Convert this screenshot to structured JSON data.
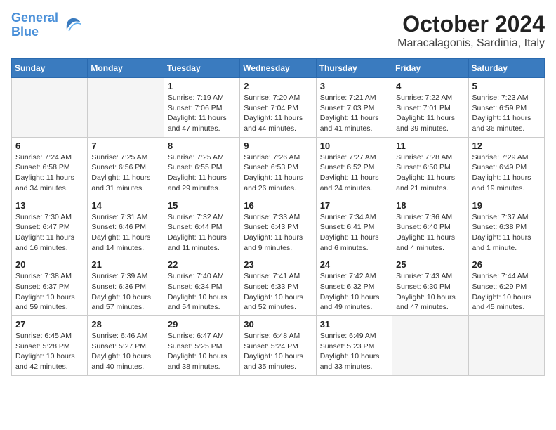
{
  "header": {
    "logo_line1": "General",
    "logo_line2": "Blue",
    "month_year": "October 2024",
    "location": "Maracalagonis, Sardinia, Italy"
  },
  "days_of_week": [
    "Sunday",
    "Monday",
    "Tuesday",
    "Wednesday",
    "Thursday",
    "Friday",
    "Saturday"
  ],
  "weeks": [
    [
      {
        "day": "",
        "info": ""
      },
      {
        "day": "",
        "info": ""
      },
      {
        "day": "1",
        "info": "Sunrise: 7:19 AM\nSunset: 7:06 PM\nDaylight: 11 hours and 47 minutes."
      },
      {
        "day": "2",
        "info": "Sunrise: 7:20 AM\nSunset: 7:04 PM\nDaylight: 11 hours and 44 minutes."
      },
      {
        "day": "3",
        "info": "Sunrise: 7:21 AM\nSunset: 7:03 PM\nDaylight: 11 hours and 41 minutes."
      },
      {
        "day": "4",
        "info": "Sunrise: 7:22 AM\nSunset: 7:01 PM\nDaylight: 11 hours and 39 minutes."
      },
      {
        "day": "5",
        "info": "Sunrise: 7:23 AM\nSunset: 6:59 PM\nDaylight: 11 hours and 36 minutes."
      }
    ],
    [
      {
        "day": "6",
        "info": "Sunrise: 7:24 AM\nSunset: 6:58 PM\nDaylight: 11 hours and 34 minutes."
      },
      {
        "day": "7",
        "info": "Sunrise: 7:25 AM\nSunset: 6:56 PM\nDaylight: 11 hours and 31 minutes."
      },
      {
        "day": "8",
        "info": "Sunrise: 7:25 AM\nSunset: 6:55 PM\nDaylight: 11 hours and 29 minutes."
      },
      {
        "day": "9",
        "info": "Sunrise: 7:26 AM\nSunset: 6:53 PM\nDaylight: 11 hours and 26 minutes."
      },
      {
        "day": "10",
        "info": "Sunrise: 7:27 AM\nSunset: 6:52 PM\nDaylight: 11 hours and 24 minutes."
      },
      {
        "day": "11",
        "info": "Sunrise: 7:28 AM\nSunset: 6:50 PM\nDaylight: 11 hours and 21 minutes."
      },
      {
        "day": "12",
        "info": "Sunrise: 7:29 AM\nSunset: 6:49 PM\nDaylight: 11 hours and 19 minutes."
      }
    ],
    [
      {
        "day": "13",
        "info": "Sunrise: 7:30 AM\nSunset: 6:47 PM\nDaylight: 11 hours and 16 minutes."
      },
      {
        "day": "14",
        "info": "Sunrise: 7:31 AM\nSunset: 6:46 PM\nDaylight: 11 hours and 14 minutes."
      },
      {
        "day": "15",
        "info": "Sunrise: 7:32 AM\nSunset: 6:44 PM\nDaylight: 11 hours and 11 minutes."
      },
      {
        "day": "16",
        "info": "Sunrise: 7:33 AM\nSunset: 6:43 PM\nDaylight: 11 hours and 9 minutes."
      },
      {
        "day": "17",
        "info": "Sunrise: 7:34 AM\nSunset: 6:41 PM\nDaylight: 11 hours and 6 minutes."
      },
      {
        "day": "18",
        "info": "Sunrise: 7:36 AM\nSunset: 6:40 PM\nDaylight: 11 hours and 4 minutes."
      },
      {
        "day": "19",
        "info": "Sunrise: 7:37 AM\nSunset: 6:38 PM\nDaylight: 11 hours and 1 minute."
      }
    ],
    [
      {
        "day": "20",
        "info": "Sunrise: 7:38 AM\nSunset: 6:37 PM\nDaylight: 10 hours and 59 minutes."
      },
      {
        "day": "21",
        "info": "Sunrise: 7:39 AM\nSunset: 6:36 PM\nDaylight: 10 hours and 57 minutes."
      },
      {
        "day": "22",
        "info": "Sunrise: 7:40 AM\nSunset: 6:34 PM\nDaylight: 10 hours and 54 minutes."
      },
      {
        "day": "23",
        "info": "Sunrise: 7:41 AM\nSunset: 6:33 PM\nDaylight: 10 hours and 52 minutes."
      },
      {
        "day": "24",
        "info": "Sunrise: 7:42 AM\nSunset: 6:32 PM\nDaylight: 10 hours and 49 minutes."
      },
      {
        "day": "25",
        "info": "Sunrise: 7:43 AM\nSunset: 6:30 PM\nDaylight: 10 hours and 47 minutes."
      },
      {
        "day": "26",
        "info": "Sunrise: 7:44 AM\nSunset: 6:29 PM\nDaylight: 10 hours and 45 minutes."
      }
    ],
    [
      {
        "day": "27",
        "info": "Sunrise: 6:45 AM\nSunset: 5:28 PM\nDaylight: 10 hours and 42 minutes."
      },
      {
        "day": "28",
        "info": "Sunrise: 6:46 AM\nSunset: 5:27 PM\nDaylight: 10 hours and 40 minutes."
      },
      {
        "day": "29",
        "info": "Sunrise: 6:47 AM\nSunset: 5:25 PM\nDaylight: 10 hours and 38 minutes."
      },
      {
        "day": "30",
        "info": "Sunrise: 6:48 AM\nSunset: 5:24 PM\nDaylight: 10 hours and 35 minutes."
      },
      {
        "day": "31",
        "info": "Sunrise: 6:49 AM\nSunset: 5:23 PM\nDaylight: 10 hours and 33 minutes."
      },
      {
        "day": "",
        "info": ""
      },
      {
        "day": "",
        "info": ""
      }
    ]
  ]
}
